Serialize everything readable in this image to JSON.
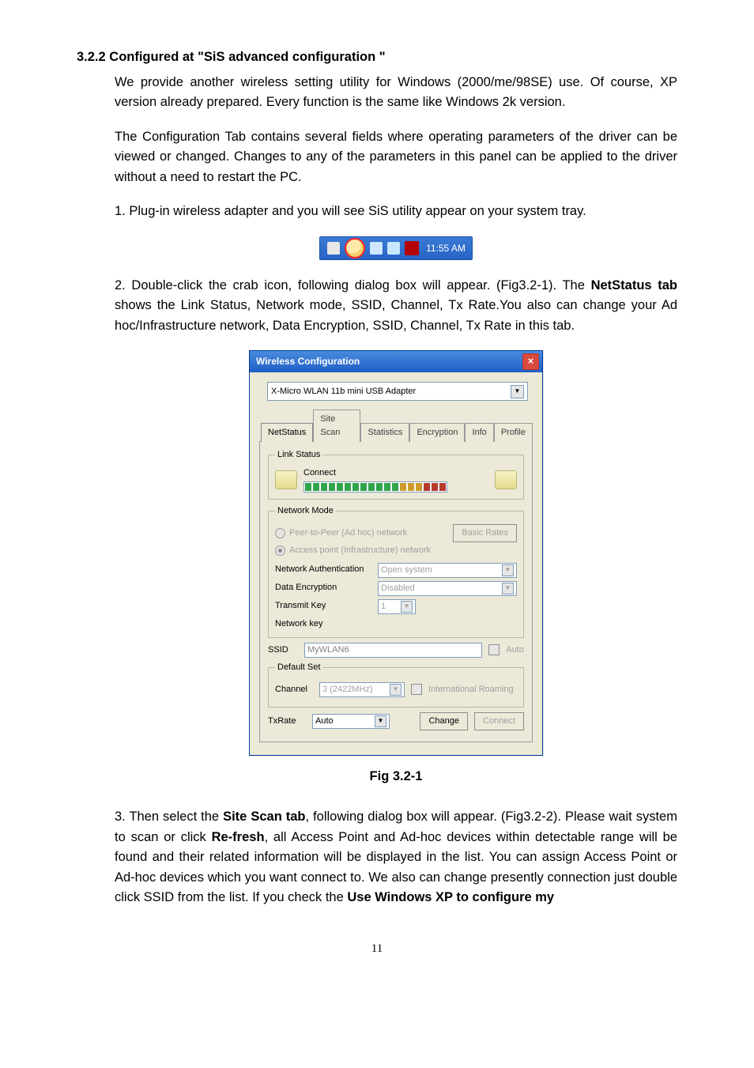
{
  "section": {
    "number_title": "3.2.2 Configured at \"SiS advanced configuration \"",
    "p1": "We provide another wireless setting utility for Windows (2000/me/98SE) use. Of course, XP version already prepared. Every function is the same like Windows 2k version.",
    "p2": "The Configuration Tab contains several fields where operating parameters of the driver can be viewed or changed. Changes to any of the parameters in this panel can be applied to the driver without a need to restart the PC.",
    "p3": "1. Plug-in wireless adapter and you will see SiS utility appear on your system tray.",
    "p4a": "2. Double-click the crab icon, following dialog box will appear. (Fig3.2-1). The ",
    "p4b": "NetStatus tab",
    "p4c": " shows the Link Status, Network mode, SSID, Channel, Tx Rate.You also can change your Ad hoc/Infrastructure network, Data Encryption, SSID, Channel, Tx Rate in this tab.",
    "p5a": "3. Then select the ",
    "p5b": "Site Scan tab",
    "p5c": ", following dialog box will appear. (Fig3.2-2). Please wait system to scan or click ",
    "p5d": "Re-fresh",
    "p5e": ", all Access Point and Ad-hoc devices within detectable range will be found and their related information will be displayed in the list. You can assign Access Point or Ad-hoc devices which you want connect to. We also can change presently connection just double click SSID from the list. If you check the ",
    "p5f": "Use Windows XP to configure my"
  },
  "systray": {
    "time": "11:55 AM"
  },
  "dialog": {
    "title": "Wireless Configuration",
    "adapter": "X-Micro WLAN 11b mini USB Adapter",
    "tabs": [
      "NetStatus",
      "Site Scan",
      "Statistics",
      "Encryption",
      "Info",
      "Profile"
    ],
    "link_status": {
      "legend": "Link Status",
      "label": "Connect"
    },
    "network_mode": {
      "legend": "Network Mode",
      "opt1": "Peer-to-Peer (Ad hoc) network",
      "opt2": "Access point (Infrastructure) network",
      "basic_rates": "Basic Rates"
    },
    "auth": {
      "net_auth_label": "Network Authentication",
      "net_auth_value": "Open system",
      "data_enc_label": "Data Encryption",
      "data_enc_value": "Disabled",
      "tx_key_label": "Transmit Key",
      "tx_key_value": "1",
      "net_key_label": "Network key"
    },
    "ssid": {
      "label": "SSID",
      "value": "MyWLAN6",
      "auto": "Auto"
    },
    "default_set": {
      "legend": "Default Set",
      "channel_label": "Channel",
      "channel_value": "3  (2422MHz)",
      "roaming": "International Roaming"
    },
    "txrate": {
      "label": "TxRate",
      "value": "Auto"
    },
    "buttons": {
      "change": "Change",
      "connect": "Connect"
    }
  },
  "figcaption": "Fig 3.2-1",
  "page_number": "11"
}
